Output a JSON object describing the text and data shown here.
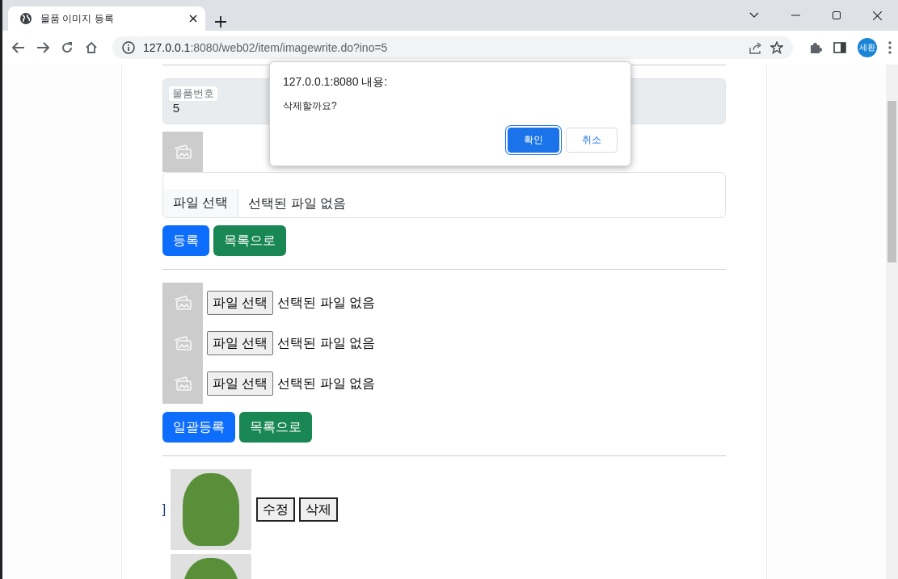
{
  "browser": {
    "tab": {
      "title": "물품 이미지 등록"
    },
    "address": {
      "host": "127.0.0.1",
      "path": ":8080/web02/item/imagewrite.do?ino=5"
    },
    "profile": "세환"
  },
  "form": {
    "item_number": {
      "label": "물품번호",
      "value": "5"
    },
    "file": {
      "button": "파일 선택",
      "status": "선택된 파일 없음"
    },
    "buttons": [
      {
        "label": "등록",
        "kind": "primary"
      },
      {
        "label": "목록으로",
        "kind": "success"
      }
    ]
  },
  "batch": {
    "rows": [
      {
        "button": "파일 선택",
        "status": "선택된 파일 없음"
      },
      {
        "button": "파일 선택",
        "status": "선택된 파일 없음"
      },
      {
        "button": "파일 선택",
        "status": "선택된 파일 없음"
      }
    ],
    "buttons": [
      {
        "label": "일괄등록",
        "kind": "primary"
      },
      {
        "label": "목록으로",
        "kind": "success"
      }
    ]
  },
  "images": [
    {
      "kind": "photo",
      "marker": "]",
      "actions": [
        "수정",
        "삭제"
      ]
    },
    {
      "kind": "photo"
    }
  ],
  "dialog": {
    "title": "127.0.0.1:8080 내용:",
    "message": "삭제할까요?",
    "buttons": [
      {
        "label": "확인",
        "kind": "primary"
      },
      {
        "label": "취소",
        "kind": "secondary"
      }
    ]
  }
}
